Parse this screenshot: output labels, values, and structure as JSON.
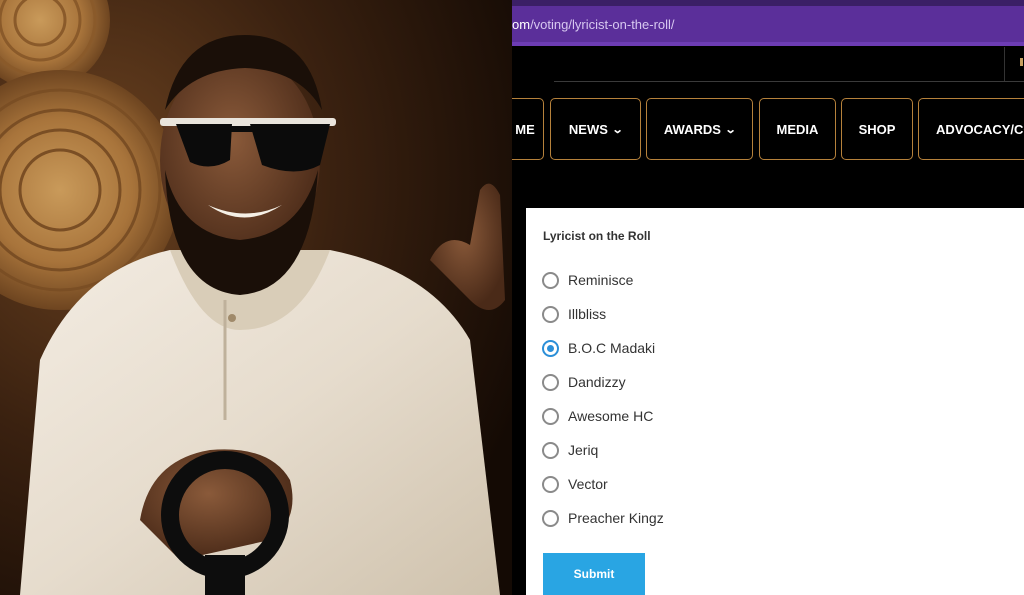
{
  "browser": {
    "url_prefix": "om",
    "url_path": "/voting/lyricist-on-the-roll/"
  },
  "nav": {
    "items": [
      {
        "label": "ME",
        "has_dropdown": false
      },
      {
        "label": "NEWS",
        "has_dropdown": true
      },
      {
        "label": "AWARDS",
        "has_dropdown": true
      },
      {
        "label": "MEDIA",
        "has_dropdown": false
      },
      {
        "label": "SHOP",
        "has_dropdown": false
      },
      {
        "label": "ADVOCACY/CO",
        "has_dropdown": false
      }
    ],
    "dropdown_icon": "chevron-down-icon",
    "border_color": "#b5813b"
  },
  "poll": {
    "title": "Lyricist on the Roll",
    "options": [
      {
        "label": "Reminisce",
        "checked": false
      },
      {
        "label": "Illbliss",
        "checked": false
      },
      {
        "label": "B.O.C Madaki",
        "checked": true
      },
      {
        "label": "Dandizzy",
        "checked": false
      },
      {
        "label": "Awesome HC",
        "checked": false
      },
      {
        "label": "Jeriq",
        "checked": false
      },
      {
        "label": "Vector",
        "checked": false
      },
      {
        "label": "Preacher Kingz",
        "checked": false
      }
    ],
    "submit_label": "Submit",
    "accent_color": "#2b8fd8",
    "button_color": "#29a5e3"
  },
  "colors": {
    "url_bar": "#5b2f9a",
    "page_background": "#000000"
  }
}
